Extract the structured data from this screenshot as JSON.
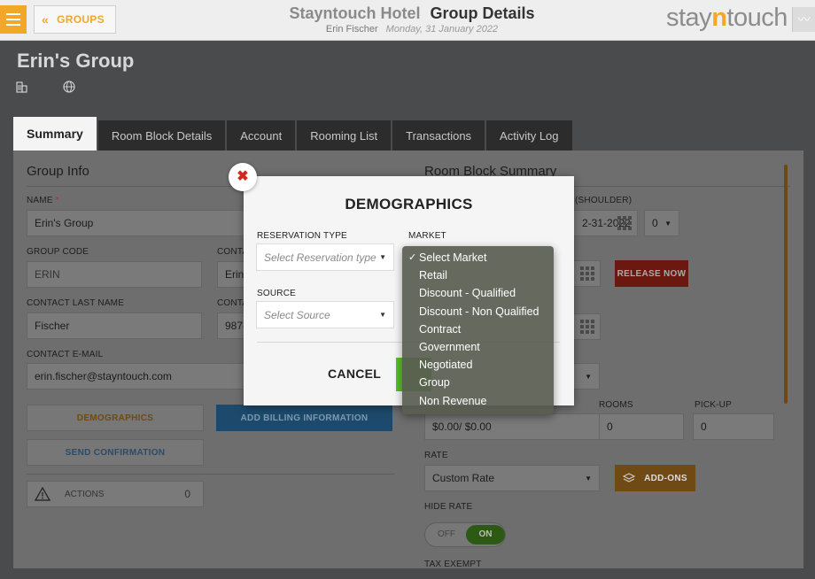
{
  "header": {
    "back_label": "GROUPS",
    "hotel_name": "Stayntouch Hotel",
    "page_title": "Group Details",
    "user_name": "Erin Fischer",
    "date": "Monday, 31 January 2022",
    "logo_pre": "stay",
    "logo_n": "n",
    "logo_post": "touch"
  },
  "group": {
    "name": "Erin's Group"
  },
  "tabs": [
    {
      "label": "Summary",
      "active": true
    },
    {
      "label": "Room Block Details"
    },
    {
      "label": "Account"
    },
    {
      "label": "Rooming List"
    },
    {
      "label": "Transactions"
    },
    {
      "label": "Activity Log"
    }
  ],
  "group_info": {
    "title": "Group Info",
    "name_label": "NAME",
    "name_required": "*",
    "name_value": "Erin's Group",
    "group_code_label": "GROUP CODE",
    "group_code_value": "ERIN",
    "contact_first_label": "CONTA",
    "contact_first_value": "Erin",
    "contact_last_label": "CONTACT LAST NAME",
    "contact_last_value": "Fischer",
    "contact_phone_label": "CONTA",
    "contact_phone_value": "987-",
    "email_label": "CONTACT E-MAIL",
    "email_value": "erin.fischer@stayntouch.com",
    "demographics_button": "DEMOGRAPHICS",
    "billing_button": "ADD BILLING INFORMATION",
    "confirmation_button": "SEND CONFIRMATION",
    "actions_label": "ACTIONS",
    "actions_count": "0"
  },
  "room_block": {
    "title": "Room Block Summary",
    "shoulder_label": "(SHOULDER)",
    "shoulder_date": "2-31-2022",
    "shoulder_count": "0",
    "release_button": "RELEASE NOW",
    "rooms_label": "ROOMS",
    "rooms_value": "0",
    "pickup_label": "PICK-UP",
    "pickup_value": "0",
    "revenue_value": "$0.00/ $0.00",
    "rate_label": "RATE",
    "rate_value": "Custom Rate",
    "addons_button": "ADD-ONS",
    "hide_rate_label": "HIDE RATE",
    "toggle_off": "OFF",
    "toggle_on": "ON",
    "tax_exempt_label": "TAX EXEMPT"
  },
  "modal": {
    "title": "DEMOGRAPHICS",
    "reservation_type_label": "RESERVATION TYPE",
    "reservation_type_placeholder": "Select Reservation type",
    "market_label": "MARKET",
    "source_label": "SOURCE",
    "source_placeholder": "Select Source",
    "cancel_label": "CANCEL"
  },
  "market_options": [
    {
      "label": "Select Market",
      "selected": true
    },
    {
      "label": "Retail"
    },
    {
      "label": "Discount - Qualified"
    },
    {
      "label": "Discount - Non Qualified"
    },
    {
      "label": "Contract"
    },
    {
      "label": "Government"
    },
    {
      "label": "Negotiated"
    },
    {
      "label": "Group"
    },
    {
      "label": "Non Revenue"
    }
  ],
  "colors": {
    "accent": "#f2a72a",
    "release": "#d32d1e",
    "billing": "#3c8fd2",
    "toggle_on": "#5cbf26",
    "close_x": "#d3281b"
  }
}
